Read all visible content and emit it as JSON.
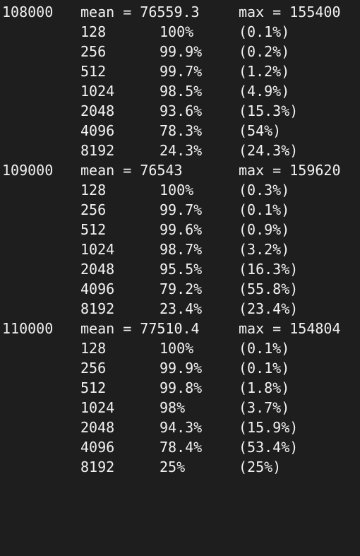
{
  "blocks": [
    {
      "header": {
        "count": "108000",
        "mean": "mean = 76559.3",
        "max": "max = 155400"
      },
      "rows": [
        {
          "size": "128",
          "pct": "100%",
          "share": "(0.1%)"
        },
        {
          "size": "256",
          "pct": "99.9%",
          "share": "(0.2%)"
        },
        {
          "size": "512",
          "pct": "99.7%",
          "share": "(1.2%)"
        },
        {
          "size": "1024",
          "pct": "98.5%",
          "share": "(4.9%)"
        },
        {
          "size": "2048",
          "pct": "93.6%",
          "share": "(15.3%)"
        },
        {
          "size": "4096",
          "pct": "78.3%",
          "share": "(54%)"
        },
        {
          "size": "8192",
          "pct": "24.3%",
          "share": "(24.3%)"
        }
      ]
    },
    {
      "header": {
        "count": "109000",
        "mean": "mean = 76543",
        "max": "max = 159620"
      },
      "rows": [
        {
          "size": "128",
          "pct": "100%",
          "share": "(0.3%)"
        },
        {
          "size": "256",
          "pct": "99.7%",
          "share": "(0.1%)"
        },
        {
          "size": "512",
          "pct": "99.6%",
          "share": "(0.9%)"
        },
        {
          "size": "1024",
          "pct": "98.7%",
          "share": "(3.2%)"
        },
        {
          "size": "2048",
          "pct": "95.5%",
          "share": "(16.3%)"
        },
        {
          "size": "4096",
          "pct": "79.2%",
          "share": "(55.8%)"
        },
        {
          "size": "8192",
          "pct": "23.4%",
          "share": "(23.4%)"
        }
      ]
    },
    {
      "header": {
        "count": "110000",
        "mean": "mean = 77510.4",
        "max": "max = 154804"
      },
      "rows": [
        {
          "size": "128",
          "pct": "100%",
          "share": "(0.1%)"
        },
        {
          "size": "256",
          "pct": "99.9%",
          "share": "(0.1%)"
        },
        {
          "size": "512",
          "pct": "99.8%",
          "share": "(1.8%)"
        },
        {
          "size": "1024",
          "pct": "98%",
          "share": "(3.7%)"
        },
        {
          "size": "2048",
          "pct": "94.3%",
          "share": "(15.9%)"
        },
        {
          "size": "4096",
          "pct": "78.4%",
          "share": "(53.4%)"
        },
        {
          "size": "8192",
          "pct": "25%",
          "share": "(25%)"
        }
      ]
    }
  ]
}
